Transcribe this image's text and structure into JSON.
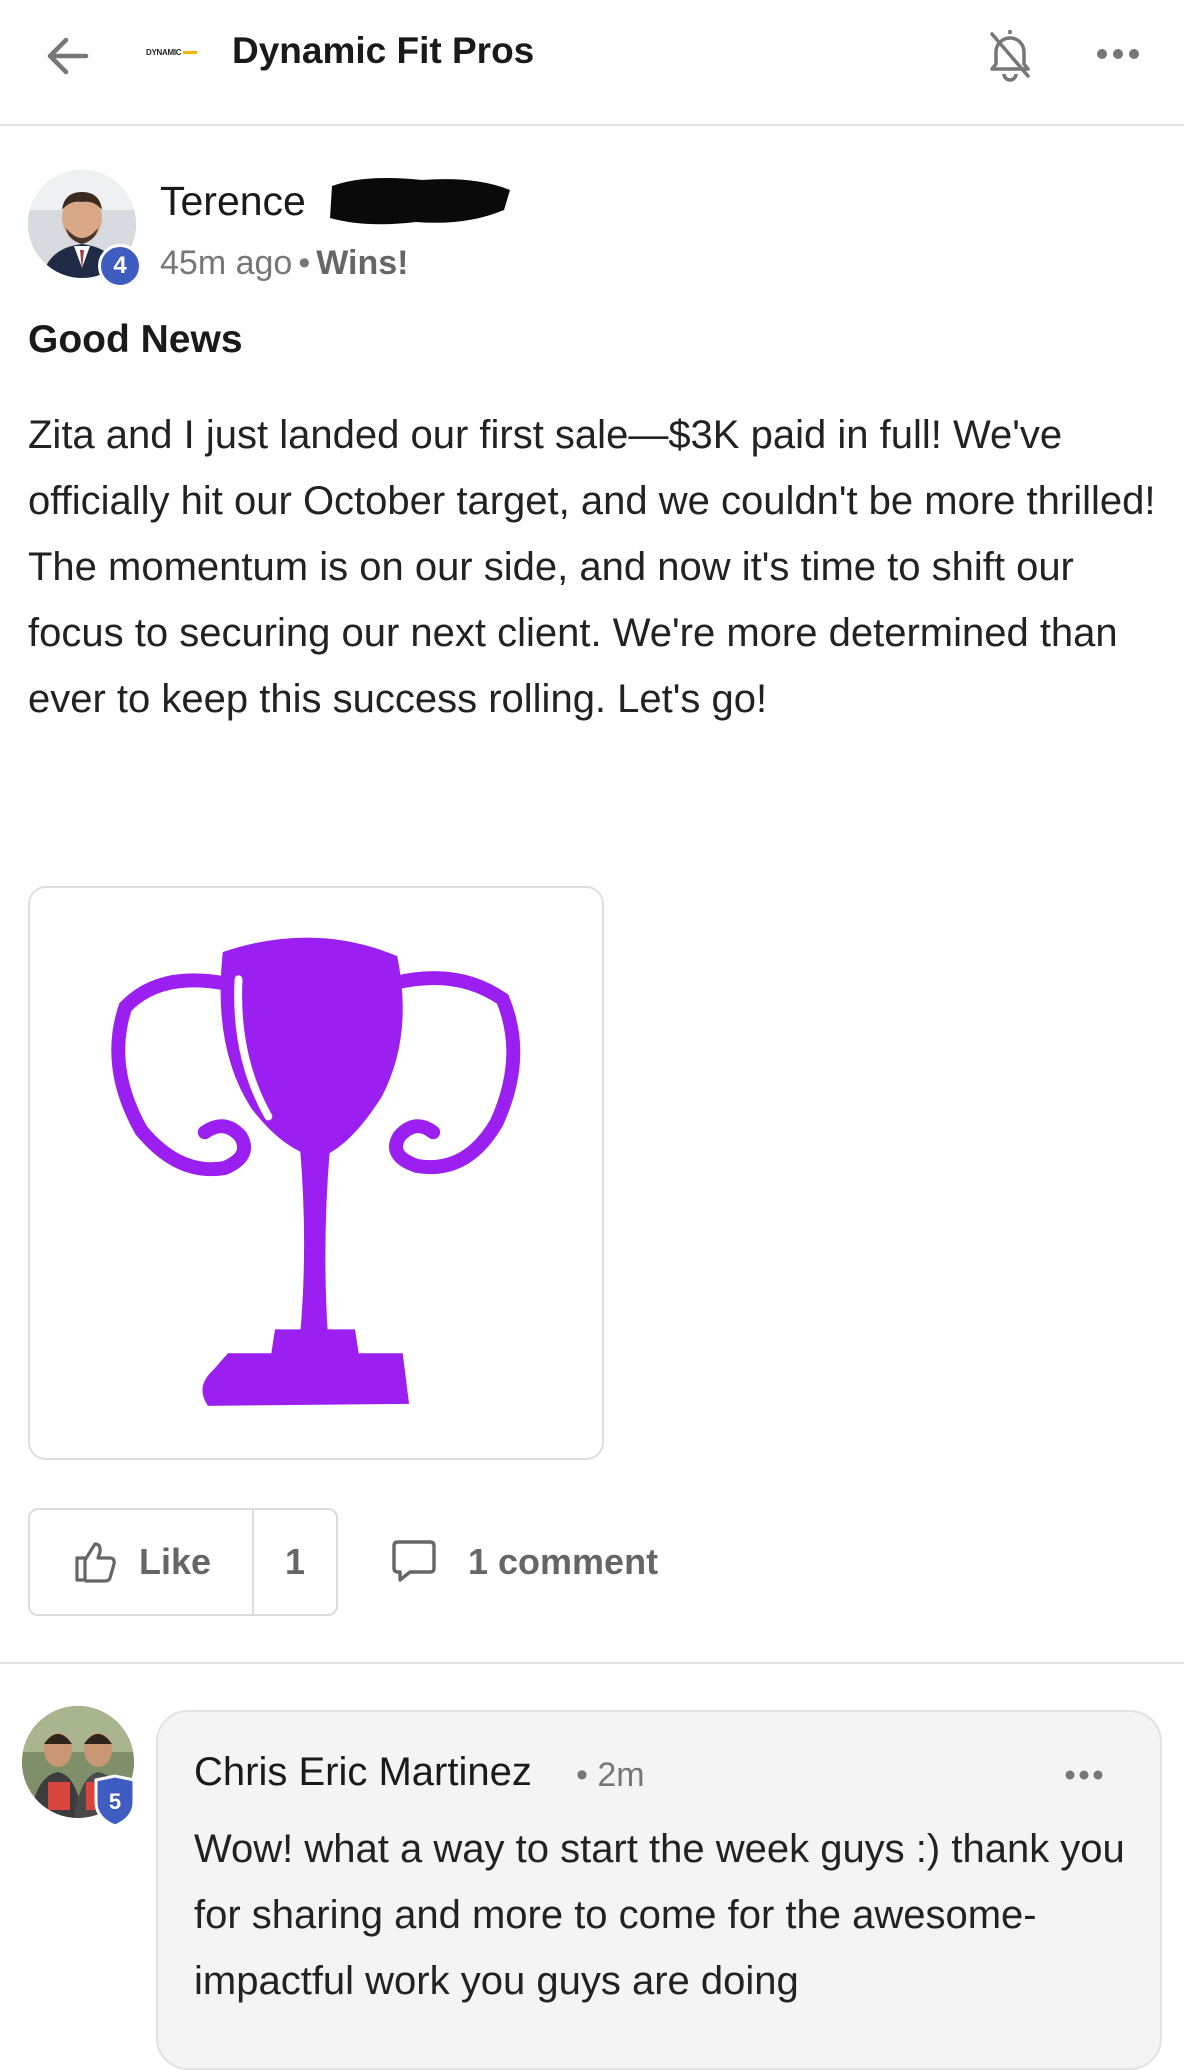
{
  "header": {
    "logo_text": "DYNAMIC",
    "title": "Dynamic Fit Pros",
    "icons": [
      "back-arrow-icon",
      "bell-icon",
      "more-horizontal-icon"
    ]
  },
  "post": {
    "author": "Terence",
    "level": "4",
    "time": "45m ago",
    "separator": "•",
    "category": "Wins!",
    "title": "Good News",
    "body": "Zita and I just landed our first sale—$3K paid in full! We've officially hit our October target, and we couldn't be more thrilled! The momentum is on our side, and now it's time to shift our focus to securing our next client. We're more determined than ever to keep this success rolling. Let's go!",
    "image_icon": "trophy-icon",
    "image_color": "#9b1ff0",
    "like_label": "Like",
    "like_count": "1",
    "comment_label": "1 comment"
  },
  "comment": {
    "author": "Chris Eric Martinez",
    "time": "• 2m",
    "level": "5",
    "text": "Wow! what a way to start the week guys :) thank you for sharing and more to come for the awesome-impactful work you guys are doing"
  },
  "colors": {
    "level_badge": "#3f5cc1",
    "trophy": "#9b1ff0",
    "logo_accent": "#f2b400"
  }
}
